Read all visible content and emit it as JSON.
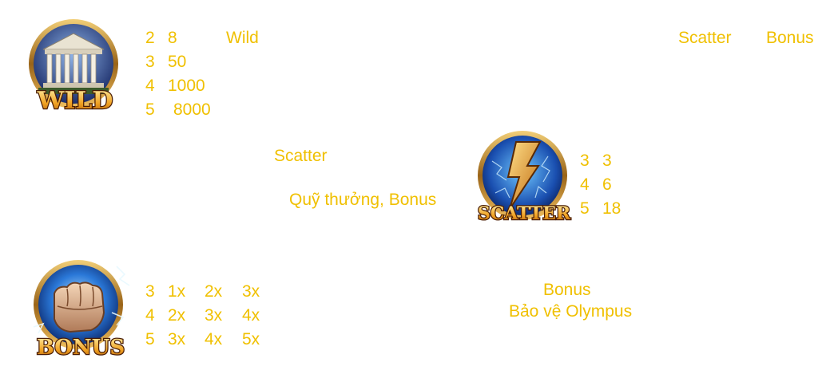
{
  "symbols": {
    "wild": {
      "icon": "wild-temple-icon",
      "badge": "WILD",
      "pays": [
        {
          "count": "2",
          "value": "8"
        },
        {
          "count": "3",
          "value": "50"
        },
        {
          "count": "4",
          "value": "1000"
        },
        {
          "count": "5",
          "value": "8000"
        }
      ],
      "label": "Wild"
    },
    "scatter": {
      "icon": "scatter-lightning-icon",
      "badge": "SCATTER",
      "pays": [
        {
          "count": "3",
          "value": "3"
        },
        {
          "count": "4",
          "value": "6"
        },
        {
          "count": "5",
          "value": "18"
        }
      ]
    },
    "bonus": {
      "icon": "bonus-fist-icon",
      "badge": "BONUS",
      "pays": [
        {
          "count": "3",
          "m1": "1x",
          "m2": "2x",
          "m3": "3x"
        },
        {
          "count": "4",
          "m1": "2x",
          "m2": "3x",
          "m3": "4x"
        },
        {
          "count": "5",
          "m1": "3x",
          "m2": "4x",
          "m3": "5x"
        }
      ]
    }
  },
  "texts": {
    "top_scatter": "Scatter",
    "top_bonus": "Bonus",
    "mid_scatter": "Scatter",
    "mid_prize": "Quỹ thưởng, Bonus",
    "bottom_bonus": "Bonus",
    "bottom_olympus": "Bảo vệ Olympus"
  },
  "colors": {
    "text": "#f0c000",
    "badge_gold": "#e8a020",
    "ring_gold": "#c89030"
  }
}
